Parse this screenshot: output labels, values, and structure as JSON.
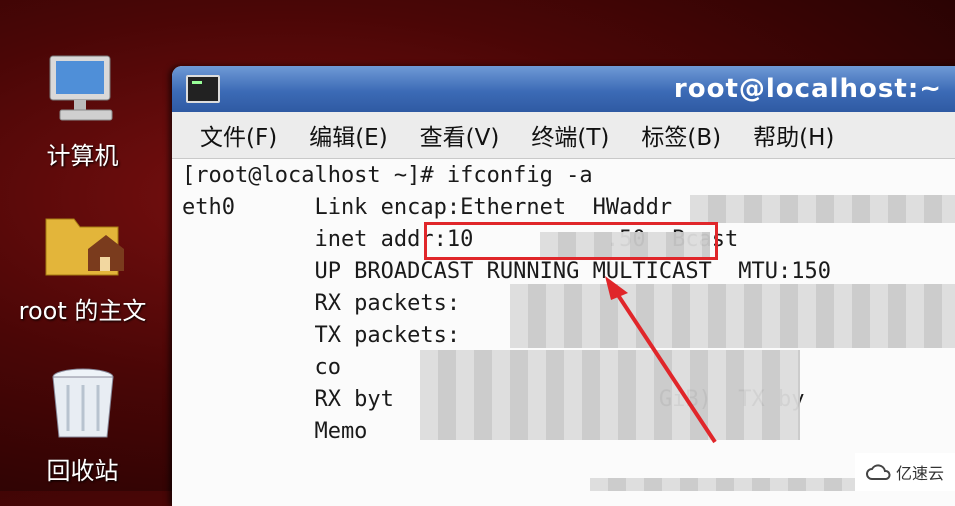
{
  "desktop": {
    "icons": [
      {
        "label": "计算机"
      },
      {
        "label": "root 的主文"
      },
      {
        "label": "回收站"
      }
    ]
  },
  "window": {
    "title": "root@localhost:~",
    "menu": [
      "文件(F)",
      "编辑(E)",
      "查看(V)",
      "终端(T)",
      "标签(B)",
      "帮助(H)"
    ]
  },
  "terminal": {
    "lines": [
      "[root@localhost ~]# ifconfig -a",
      "eth0      Link encap:Ethernet  HWaddr",
      "          inet addr:10          .50  Bcast",
      "          UP BROADCAST RUNNING MULTICAST  MTU:150",
      "          RX packets:",
      "          TX packets:",
      "          co",
      "          RX byt                    GiB)  TX by",
      "          Memo"
    ]
  },
  "annotation": {
    "color": "#e0262a"
  },
  "watermark": {
    "text": "亿速云"
  }
}
